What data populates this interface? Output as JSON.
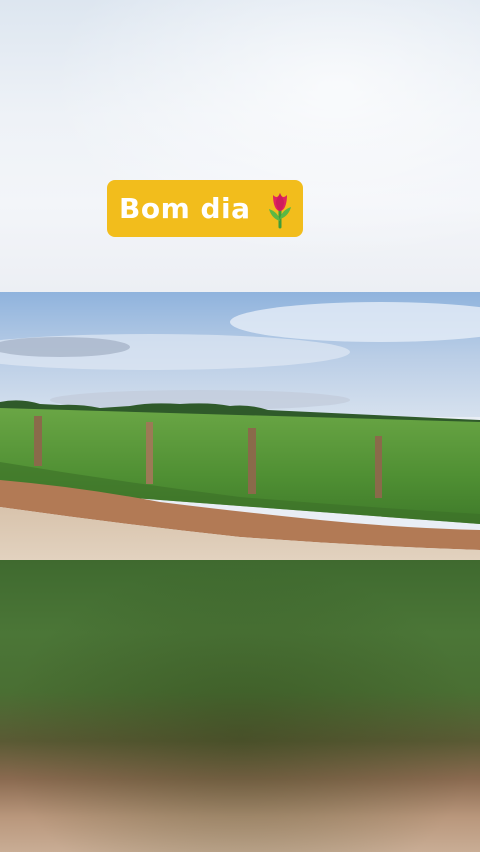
{
  "caption": {
    "text": "Bom dia",
    "emoji_icon": "tulip-icon",
    "background": "#f2bd1c"
  },
  "photo": {
    "subject": "rural-field-with-fence"
  }
}
